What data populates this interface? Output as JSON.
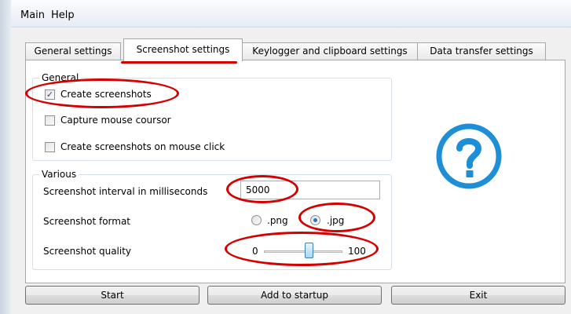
{
  "menu": {
    "items": [
      "Main",
      "Help"
    ]
  },
  "tabs": [
    {
      "label": "General settings"
    },
    {
      "label": "Screenshot settings"
    },
    {
      "label": "Keylogger and clipboard settings"
    },
    {
      "label": "Data transfer settings"
    }
  ],
  "general": {
    "title": "General",
    "create_screenshots": {
      "label": "Create screenshots",
      "checked": true
    },
    "capture_mouse": {
      "label": "Capture mouse coursor",
      "checked": false
    },
    "screenshots_on_click": {
      "label": "Create screenshots on mouse click",
      "checked": false
    }
  },
  "various": {
    "title": "Various",
    "interval": {
      "label": "Screenshot interval in milliseconds",
      "value": "5000"
    },
    "format": {
      "label": "Screenshot format",
      "options": [
        ".png",
        ".jpg"
      ],
      "selected": ".jpg"
    },
    "quality": {
      "label": "Screenshot quality",
      "min": "0",
      "max": "100",
      "fraction": 0.57
    }
  },
  "buttons": {
    "start": "Start",
    "add_to_startup": "Add to startup",
    "exit": "Exit"
  },
  "icons": {
    "help": "help-question-circle-icon"
  },
  "colors": {
    "annotation": "#d50000",
    "help_icon": "#1e8fd6"
  }
}
